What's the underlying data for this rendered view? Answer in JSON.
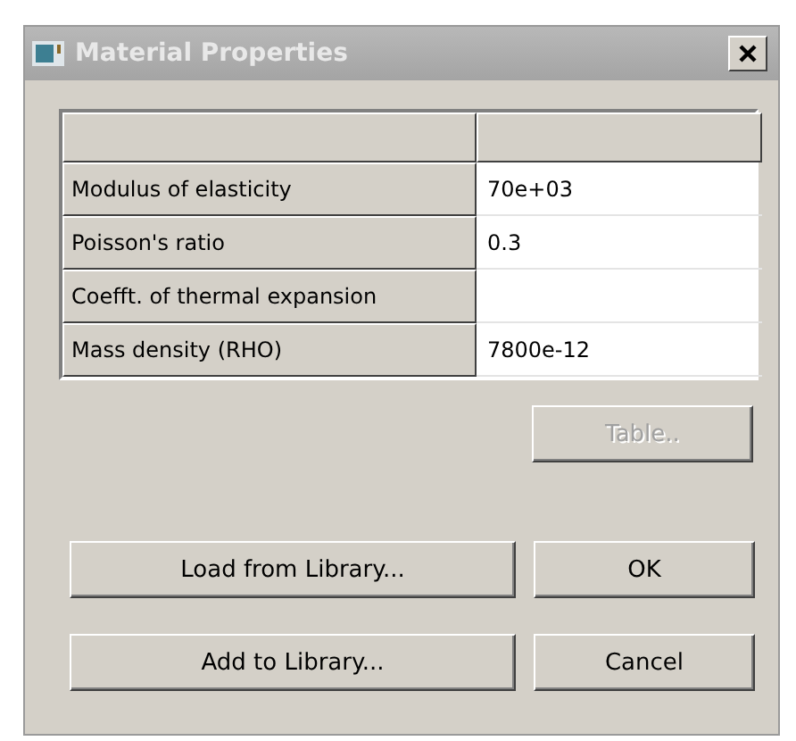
{
  "window": {
    "title": "Material Properties"
  },
  "table": {
    "rows": [
      {
        "label": "Modulus of elasticity",
        "value": "70e+03"
      },
      {
        "label": "Poisson's ratio",
        "value": "0.3"
      },
      {
        "label": "Coefft. of thermal expansion",
        "value": ""
      },
      {
        "label": "Mass density (RHO)",
        "value": "7800e-12"
      }
    ]
  },
  "buttons": [
    {
      "label": "Table..",
      "disabled": true
    },
    {
      "label": "Load from Library...",
      "disabled": false
    },
    {
      "label": "OK",
      "disabled": false
    },
    {
      "label": "Add to Library...",
      "disabled": false
    },
    {
      "label": "Cancel",
      "disabled": false
    }
  ]
}
